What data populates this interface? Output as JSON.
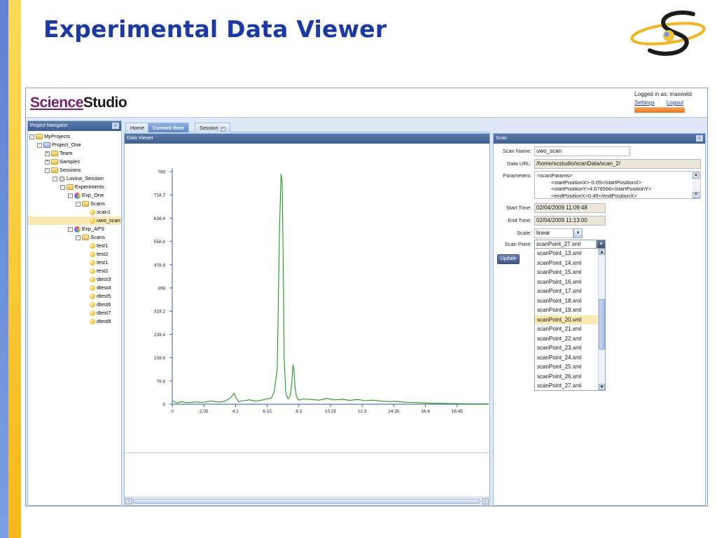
{
  "slide": {
    "title": "Experimental Data Viewer"
  },
  "app": {
    "brand_part1": "Science",
    "brand_part2": "Studio",
    "logged_in": "Logged in as: maxweld",
    "settings_link": "Settings",
    "logout_link": "Logout",
    "accent_color": "#e8731f"
  },
  "navigator": {
    "title": "Project Navigator",
    "tree": [
      {
        "label": "MyProjects",
        "depth": 0,
        "icon": "folder-icon",
        "toggle": "-"
      },
      {
        "label": "Project_One",
        "depth": 1,
        "icon": "book-icon",
        "toggle": "-"
      },
      {
        "label": "Team",
        "depth": 2,
        "icon": "folder-icon",
        "toggle": "+"
      },
      {
        "label": "Samples",
        "depth": 2,
        "icon": "folder-icon",
        "toggle": "+"
      },
      {
        "label": "Sessions",
        "depth": 2,
        "icon": "folder-icon",
        "toggle": "-"
      },
      {
        "label": "Lovina_Session",
        "depth": 3,
        "icon": "gear-icon",
        "toggle": "-"
      },
      {
        "label": "Experiments",
        "depth": 4,
        "icon": "folder-icon",
        "toggle": "-"
      },
      {
        "label": "Exp_One",
        "depth": 5,
        "icon": "flask-icon",
        "toggle": "-"
      },
      {
        "label": "Scans",
        "depth": 6,
        "icon": "folder-icon",
        "toggle": "-"
      },
      {
        "label": "scan1",
        "depth": 7,
        "icon": "dot-icon",
        "toggle": ""
      },
      {
        "label": "uwo_scan",
        "depth": 7,
        "icon": "dot-icon",
        "toggle": "",
        "selected": true
      },
      {
        "label": "Exp_APS",
        "depth": 5,
        "icon": "flask-icon",
        "toggle": "-"
      },
      {
        "label": "Scans",
        "depth": 6,
        "icon": "folder-icon",
        "toggle": "-"
      },
      {
        "label": "test1",
        "depth": 7,
        "icon": "dot-icon",
        "toggle": ""
      },
      {
        "label": "test2",
        "depth": 7,
        "icon": "dot-icon",
        "toggle": ""
      },
      {
        "label": "test1",
        "depth": 7,
        "icon": "dot-icon",
        "toggle": ""
      },
      {
        "label": "test2",
        "depth": 7,
        "icon": "dot-icon",
        "toggle": ""
      },
      {
        "label": "dtest3",
        "depth": 7,
        "icon": "dot-icon",
        "toggle": ""
      },
      {
        "label": "dtest4",
        "depth": 7,
        "icon": "dot-icon",
        "toggle": ""
      },
      {
        "label": "dtest5",
        "depth": 7,
        "icon": "dot-icon",
        "toggle": ""
      },
      {
        "label": "dtest6",
        "depth": 7,
        "icon": "dot-icon",
        "toggle": ""
      },
      {
        "label": "dtest7",
        "depth": 7,
        "icon": "dot-icon",
        "toggle": ""
      },
      {
        "label": "dtest8",
        "depth": 7,
        "icon": "dot-icon",
        "toggle": ""
      }
    ]
  },
  "tabs": {
    "home": "Home",
    "current": "Current Item",
    "session": "Session"
  },
  "viewer": {
    "title": "Data Viewer"
  },
  "scan": {
    "title": "Scan",
    "name_label": "Scan Name:",
    "name_value": "uwo_scan",
    "url_label": "Data URL:",
    "url_value": "/home/scstudio/scanData/scan_2/",
    "params_label": "Parameters:",
    "params_line1": "<scanParams>",
    "params_line2": "<startPositionX>-0.05</startPositionX>",
    "params_line3": "<startPositionY>4.676566</startPositionY>",
    "params_line4": "<endPositionX>0.45</endPositionX>",
    "start_label": "Start Time:",
    "start_value": "02/04/2009 11:09:48",
    "end_label": "End Time:",
    "end_value": "02/04/2009 11:13:00",
    "scale_label": "Scale:",
    "scale_value": "linear",
    "point_label": "Scan Point:",
    "point_value": "scanPoint_27.xml",
    "update_label": "Update",
    "options": [
      "scanPoint_13.xml",
      "scanPoint_14.xml",
      "scanPoint_15.xml",
      "scanPoint_16.xml",
      "scanPoint_17.xml",
      "scanPoint_18.xml",
      "scanPoint_19.xml",
      "scanPoint_20.xml",
      "scanPoint_21.xml",
      "scanPoint_22.xml",
      "scanPoint_23.xml",
      "scanPoint_24.xml",
      "scanPoint_25.xml",
      "scanPoint_26.xml",
      "scanPoint_27.xml"
    ],
    "highlighted_option": "scanPoint_20.xml"
  },
  "chart_data": {
    "type": "line",
    "title": "",
    "xlabel": "",
    "ylabel": "",
    "xlim": [
      0,
      20.5
    ],
    "ylim": [
      0,
      798
    ],
    "x_ticks": [
      "0",
      "2.05",
      "4.1",
      "6.15",
      "8.2",
      "10.25",
      "12.3",
      "14.35",
      "16.4",
      "18.45"
    ],
    "y_ticks": [
      "0",
      "79.8",
      "159.6",
      "239.4",
      "319.2",
      "399",
      "478.8",
      "558.6",
      "638.4",
      "718.2",
      "798"
    ],
    "line_color": "#1d9a1d",
    "series": [
      {
        "values_x": [
          0,
          0.3,
          0.6,
          1.0,
          1.5,
          2.0,
          2.5,
          3.0,
          3.4,
          3.8,
          4.0,
          4.15,
          4.3,
          4.6,
          5.0,
          5.4,
          5.8,
          6.1,
          6.4,
          6.6,
          6.8,
          6.95,
          7.05,
          7.12,
          7.18,
          7.25,
          7.35,
          7.5,
          7.65,
          7.75,
          7.82,
          7.88,
          7.95,
          8.05,
          8.2,
          8.5,
          9.0,
          9.5,
          10.0,
          10.5,
          11.0,
          11.5,
          12.0,
          12.5,
          13.0,
          13.5,
          14.0,
          14.5,
          15.0,
          15.5,
          16.0,
          16.5,
          17.0,
          17.5,
          18.0,
          18.5,
          19.0,
          19.5,
          20.0,
          20.5
        ],
        "values_y": [
          12,
          4,
          9,
          5,
          8,
          6,
          11,
          7,
          10,
          22,
          38,
          20,
          9,
          12,
          15,
          10,
          14,
          18,
          20,
          40,
          120,
          600,
          790,
          760,
          520,
          150,
          40,
          18,
          30,
          80,
          135,
          120,
          60,
          25,
          14,
          18,
          16,
          14,
          20,
          15,
          17,
          13,
          16,
          12,
          14,
          11,
          9,
          10,
          7,
          6,
          5,
          4,
          3,
          3,
          2,
          2,
          1,
          1,
          1,
          1
        ]
      }
    ]
  }
}
